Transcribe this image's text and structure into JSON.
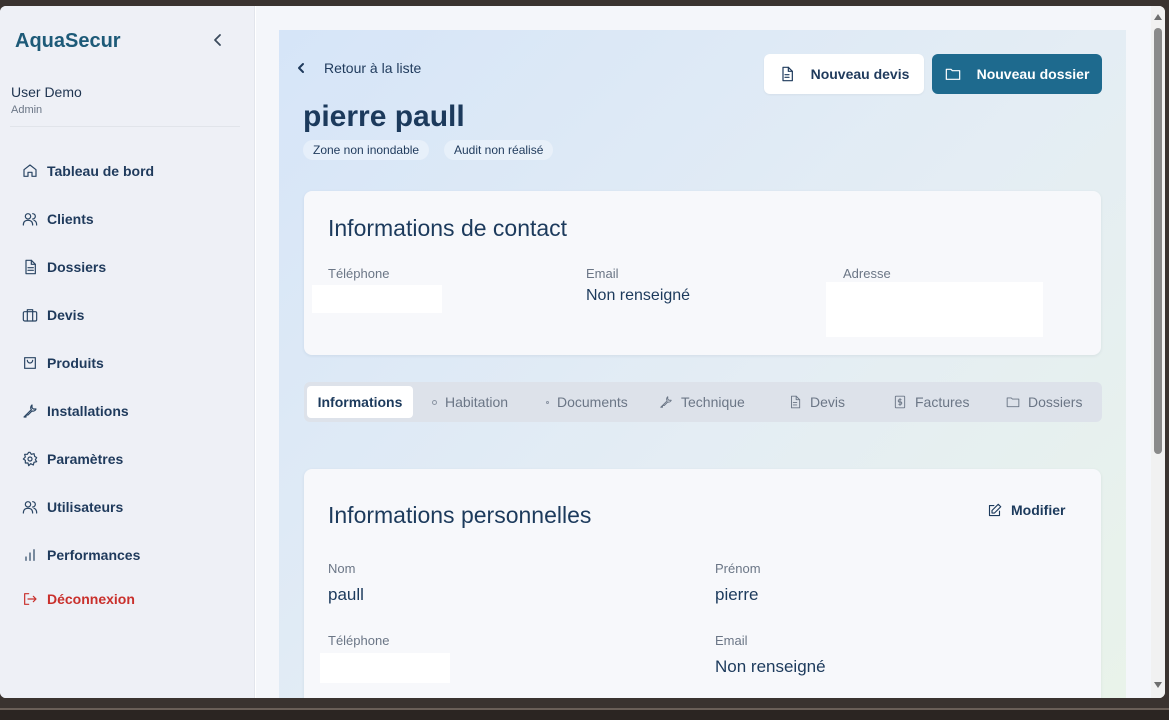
{
  "sidebar": {
    "brand": "AquaSecur",
    "user": {
      "name": "User Demo",
      "role": "Admin"
    },
    "items": [
      {
        "label": "Tableau de bord",
        "icon": "home-icon"
      },
      {
        "label": "Clients",
        "icon": "users-icon"
      },
      {
        "label": "Dossiers",
        "icon": "file-icon"
      },
      {
        "label": "Devis",
        "icon": "briefcase-icon"
      },
      {
        "label": "Produits",
        "icon": "shopping-bag-icon"
      },
      {
        "label": "Installations",
        "icon": "wrench-icon"
      },
      {
        "label": "Paramètres",
        "icon": "gear-icon"
      },
      {
        "label": "Utilisateurs",
        "icon": "users-icon"
      },
      {
        "label": "Performances",
        "icon": "bar-chart-icon"
      }
    ],
    "logout": {
      "label": "Déconnexion",
      "icon": "logout-icon",
      "color": "#c9302c"
    }
  },
  "header": {
    "back_label": "Retour à la liste",
    "new_devis_label": "Nouveau devis",
    "new_dossier_label": "Nouveau dossier",
    "client_name": "pierre paull",
    "badges": [
      "Zone non inondable",
      "Audit non réalisé"
    ]
  },
  "contact": {
    "title": "Informations de contact",
    "phone_label": "Téléphone",
    "email_label": "Email",
    "email_value": "Non renseigné",
    "address_label": "Adresse"
  },
  "tabs": [
    {
      "label": "Informations",
      "active": true
    },
    {
      "label": "Habitation"
    },
    {
      "label": "Documents"
    },
    {
      "label": "Technique"
    },
    {
      "label": "Devis"
    },
    {
      "label": "Factures"
    },
    {
      "label": "Dossiers"
    }
  ],
  "personal": {
    "title": "Informations personnelles",
    "modify_label": "Modifier",
    "nom_label": "Nom",
    "nom_value": "paull",
    "prenom_label": "Prénom",
    "prenom_value": "pierre",
    "phone_label": "Téléphone",
    "email_label": "Email",
    "email_value": "Non renseigné"
  },
  "colors": {
    "accent": "#1e6a8e",
    "brand": "#1d5a78",
    "text": "#1c3a5c",
    "danger": "#c9302c"
  }
}
